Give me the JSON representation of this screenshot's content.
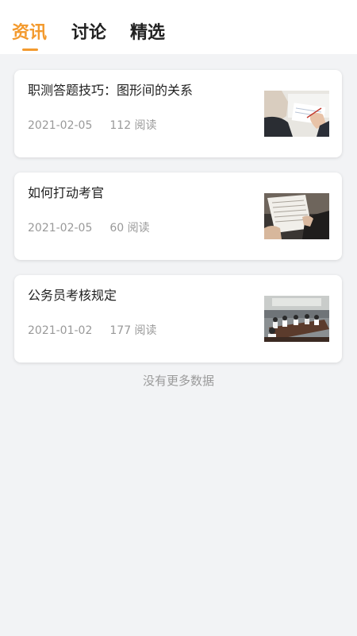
{
  "tabs": [
    {
      "label": "资讯",
      "active": true
    },
    {
      "label": "讨论",
      "active": false
    },
    {
      "label": "精选",
      "active": false
    }
  ],
  "accent_color": "#f39a2e",
  "articles": [
    {
      "title": "职测答题技巧：图形间的关系",
      "date": "2021-02-05",
      "reads": "112 阅读",
      "thumbnail": "writing-at-desk-photo"
    },
    {
      "title": "如何打动考官",
      "date": "2021-02-05",
      "reads": "60 阅读",
      "thumbnail": "reading-document-photo"
    },
    {
      "title": "公务员考核规定",
      "date": "2021-01-02",
      "reads": "177 阅读",
      "thumbnail": "meeting-room-photo"
    }
  ],
  "footer": {
    "no_more": "没有更多数据"
  }
}
